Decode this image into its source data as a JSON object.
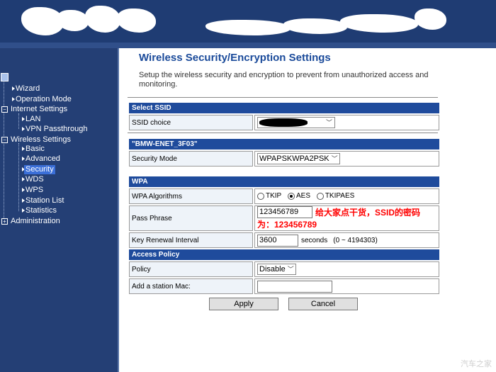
{
  "sidebar": {
    "items": [
      {
        "label": "Wizard"
      },
      {
        "label": "Operation Mode"
      },
      {
        "label": "Internet Settings"
      },
      {
        "label": "LAN"
      },
      {
        "label": "VPN Passthrough"
      },
      {
        "label": "Wireless Settings"
      },
      {
        "label": "Basic"
      },
      {
        "label": "Advanced"
      },
      {
        "label": "Security"
      },
      {
        "label": "WDS"
      },
      {
        "label": "WPS"
      },
      {
        "label": "Station List"
      },
      {
        "label": "Statistics"
      },
      {
        "label": "Administration"
      }
    ]
  },
  "main": {
    "title": "Wireless Security/Encryption Settings",
    "description": "Setup the wireless security and encryption to prevent from unauthorized access and monitoring.",
    "select_ssid": {
      "header": "Select SSID",
      "label": "SSID choice"
    },
    "ssid_section": {
      "header": "\"BMW-ENET_3F03\"",
      "security_mode_label": "Security Mode",
      "security_mode_value": "WPAPSKWPA2PSK"
    },
    "wpa": {
      "header": "WPA",
      "algorithms_label": "WPA Algorithms",
      "options": [
        "TKIP",
        "AES",
        "TKIPAES"
      ],
      "selected": "AES",
      "pass_phrase_label": "Pass Phrase",
      "pass_phrase_value": "123456789",
      "note": "给大家点干货，SSID的密码为：123456789",
      "renewal_label": "Key Renewal Interval",
      "renewal_value": "3600",
      "renewal_unit": "seconds",
      "renewal_range": "(0 ~ 4194303)"
    },
    "access_policy": {
      "header": "Access Policy",
      "policy_label": "Policy",
      "policy_value": "Disable",
      "add_mac_label": "Add a station Mac:",
      "add_mac_value": ""
    },
    "buttons": {
      "apply": "Apply",
      "cancel": "Cancel"
    }
  },
  "watermark": "汽车之家",
  "colors": {
    "header_bg": "#1f3c73",
    "sidebar_bg": "#243f75",
    "section_header": "#1f4b9c",
    "title": "#1a4a9a",
    "note": "#ff0000"
  }
}
